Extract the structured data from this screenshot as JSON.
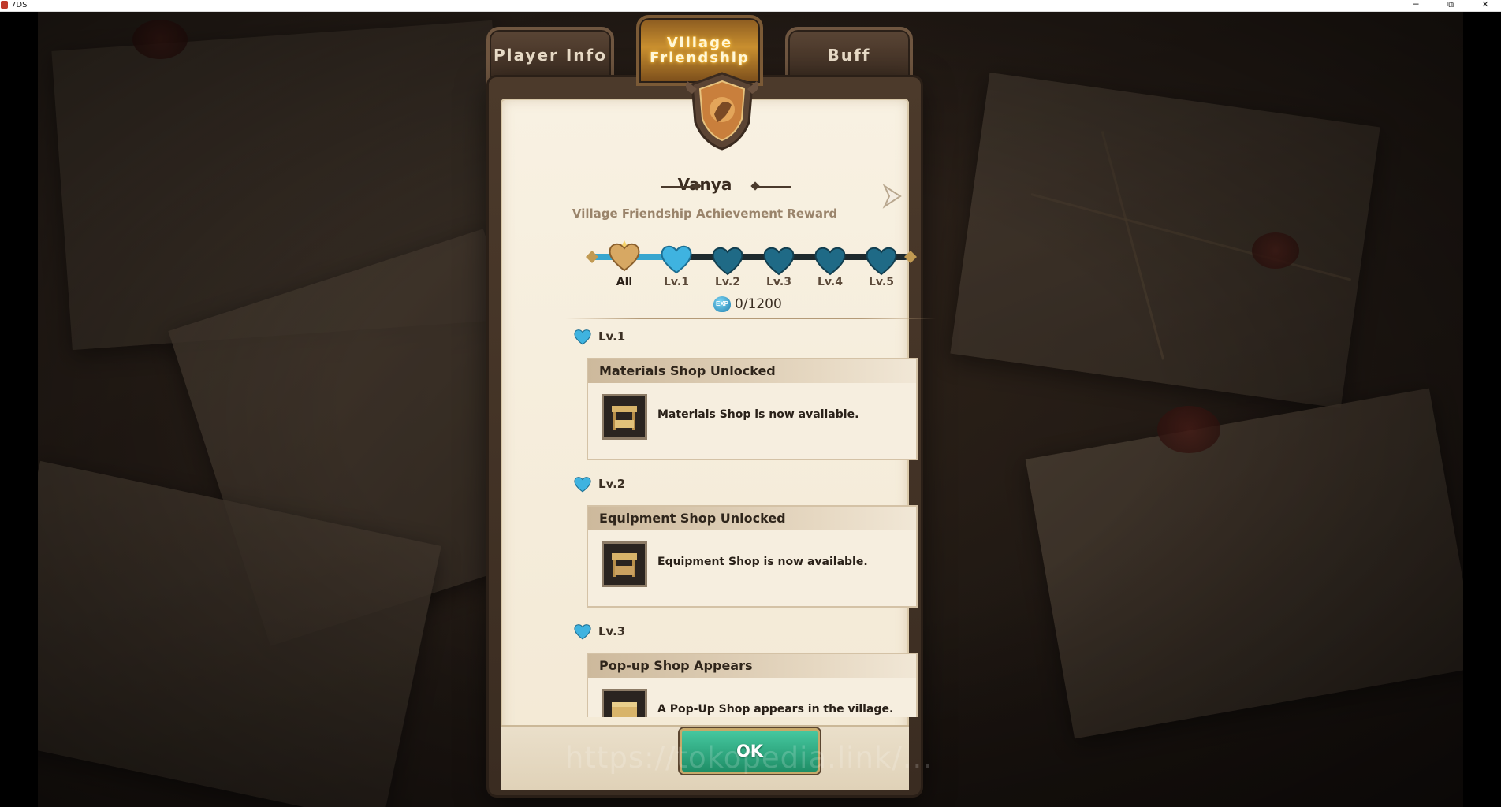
{
  "window": {
    "title": "7DS",
    "minimize": "─",
    "restore": "⧉",
    "close": "✕"
  },
  "tabs": [
    {
      "label": "Player Info",
      "active": false
    },
    {
      "label_line1": "Village",
      "label_line2": "Friendship",
      "active": true
    },
    {
      "label": "Buff",
      "active": false
    }
  ],
  "header": {
    "name": "Vanya",
    "subtitle": "Village Friendship Achievement Reward"
  },
  "levels": {
    "items": [
      "All",
      "Lv.1",
      "Lv.2",
      "Lv.3",
      "Lv.4",
      "Lv.5"
    ],
    "selected": "All",
    "exp_badge": "EXP",
    "exp": "0/1200"
  },
  "rewards": [
    {
      "level": "Lv.1",
      "title": "Materials Shop Unlocked",
      "desc": "Materials Shop is now available.",
      "icon": "shop-stall-icon"
    },
    {
      "level": "Lv.2",
      "title": "Equipment Shop Unlocked",
      "desc": "Equipment Shop is now available.",
      "icon": "shop-stall-icon"
    },
    {
      "level": "Lv.3",
      "title": "Pop-up Shop Appears",
      "desc": "A Pop-Up Shop appears in the village.",
      "icon": "chest-icon"
    }
  ],
  "footer": {
    "ok_label": "OK",
    "watermark": "https://tokopedia.link/..."
  },
  "colors": {
    "accent_heart": "#38a6cf",
    "ok_button": "#2aa77c",
    "tab_active": "#c98f2f"
  }
}
